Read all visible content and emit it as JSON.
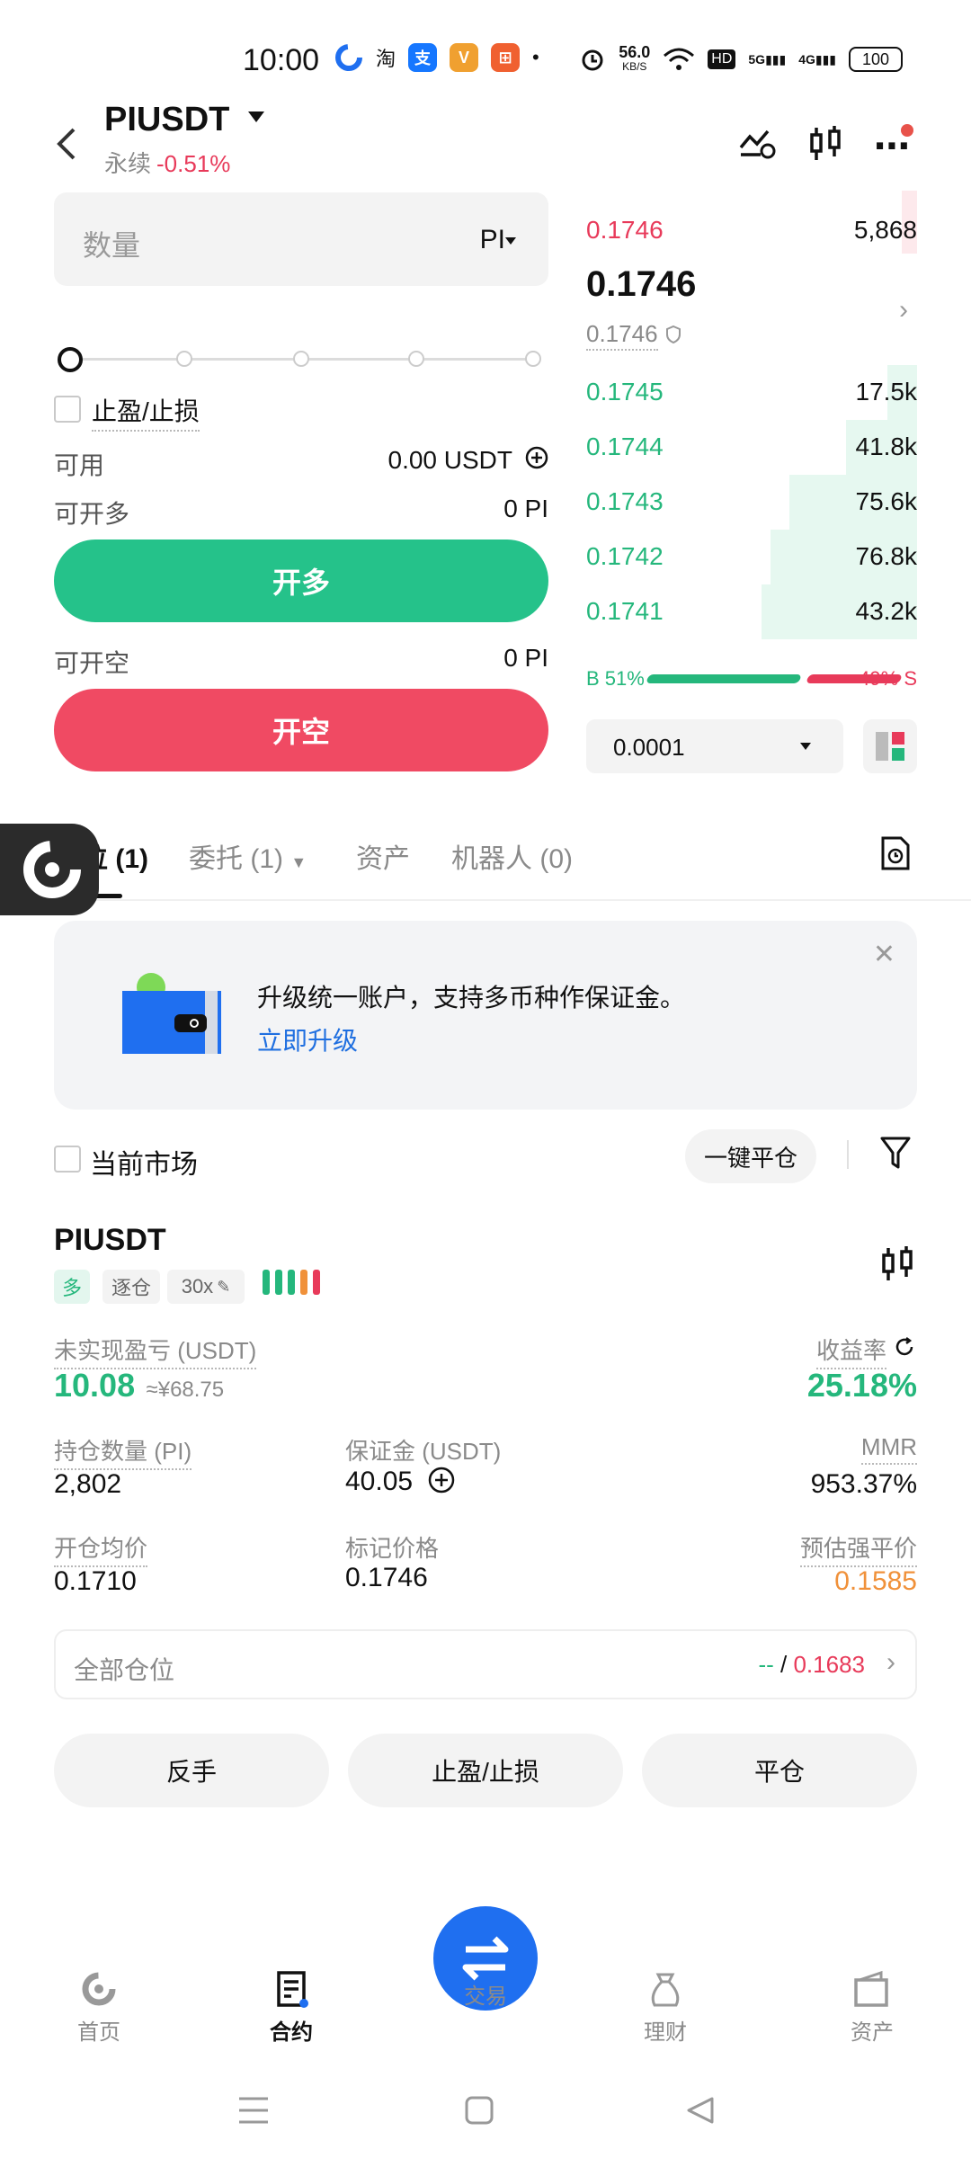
{
  "status_bar": {
    "time": "10:00",
    "net_speed_top": "56.0",
    "net_speed_unit": "KB/S",
    "hd": "HD",
    "sig1": "5G",
    "sig2": "4G",
    "battery": "100"
  },
  "header": {
    "pair": "PIUSDT",
    "type": "永续",
    "change": "-0.51%"
  },
  "order": {
    "qty_placeholder": "数量",
    "qty_unit": "PI",
    "tpsl_label": "止盈/止损",
    "available_label": "可用",
    "available_value": "0.00 USDT",
    "open_long_label": "可开多",
    "open_long_value": "0 PI",
    "long_button": "开多",
    "open_short_label": "可开空",
    "open_short_value": "0 PI",
    "short_button": "开空"
  },
  "orderbook": {
    "asks": [
      {
        "price": "0.1746",
        "qty": "5,868",
        "depth": 0.15
      }
    ],
    "last_price": "0.1746",
    "mark_price": "0.1746",
    "bids": [
      {
        "price": "0.1745",
        "qty": "17.5k",
        "depth": 0.17
      },
      {
        "price": "0.1744",
        "qty": "41.8k",
        "depth": 0.41
      },
      {
        "price": "0.1743",
        "qty": "75.6k",
        "depth": 0.74
      },
      {
        "price": "0.1742",
        "qty": "76.8k",
        "depth": 0.85
      },
      {
        "price": "0.1741",
        "qty": "43.2k",
        "depth": 0.9
      }
    ],
    "buy_ratio": "B 51%",
    "sell_ratio": "49% S",
    "precision": "0.0001"
  },
  "tabs": {
    "positions": "仓位",
    "positions_count": "(1)",
    "orders": "委托 (1)",
    "assets": "资产",
    "bots": "机器人 (0)"
  },
  "banner": {
    "text": "升级统一账户，支持多币种作保证金。",
    "link": "立即升级"
  },
  "filter": {
    "current_market": "当前市场",
    "close_all": "一键平仓"
  },
  "position": {
    "symbol": "PIUSDT",
    "side": "多",
    "margin_mode": "逐仓",
    "leverage": "30x",
    "upl_label": "未实现盈亏 (USDT)",
    "upl_value": "10.08",
    "upl_cny": "≈¥68.75",
    "roi_label": "收益率",
    "roi_value": "25.18%",
    "size_label": "持仓数量 (PI)",
    "size_value": "2,802",
    "margin_label": "保证金 (USDT)",
    "margin_value": "40.05",
    "mmr_label": "MMR",
    "mmr_value": "953.37%",
    "entry_label": "开仓均价",
    "entry_value": "0.1710",
    "mark_label": "标记价格",
    "mark_value": "0.1746",
    "liq_label": "预估强平价",
    "liq_value": "0.1585",
    "all_positions_label": "全部仓位",
    "all_positions_dash": "--",
    "all_positions_sep": " / ",
    "all_positions_value": "0.1683",
    "reverse": "反手",
    "tpsl": "止盈/止损",
    "close": "平仓"
  },
  "nav": {
    "home": "首页",
    "contract": "合约",
    "trade": "交易",
    "finance": "理财",
    "assets": "资产"
  },
  "colors": {
    "green": "#25b77c",
    "red": "#e83a5a",
    "blue": "#1f6ff0",
    "orange": "#f0913a"
  }
}
